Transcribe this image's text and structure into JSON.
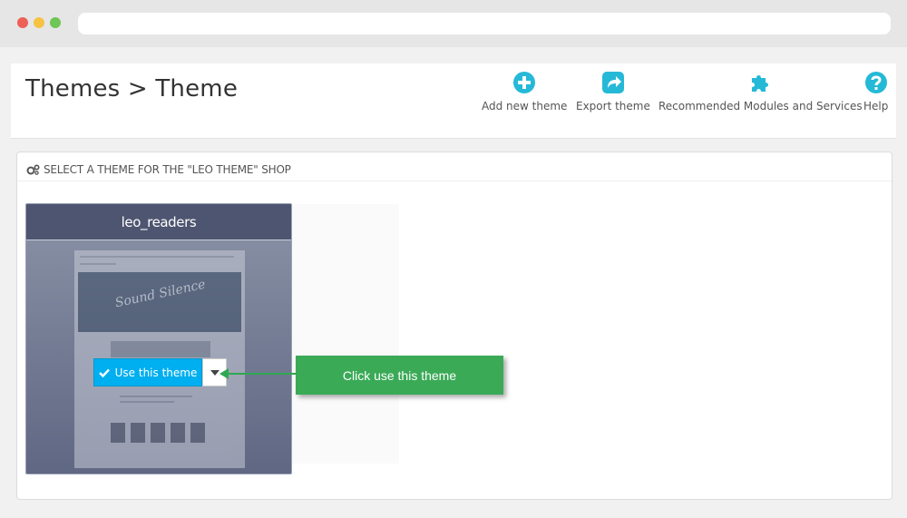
{
  "page": {
    "title": "Themes > Theme"
  },
  "toolbar": [
    {
      "label": "Add new theme",
      "icon": "plus-circle-icon"
    },
    {
      "label": "Export theme",
      "icon": "share-arrow-icon"
    },
    {
      "label": "Recommended Modules and Services",
      "icon": "puzzle-piece-icon"
    },
    {
      "label": "Help",
      "icon": "question-circle-icon"
    }
  ],
  "panel": {
    "heading": "SELECT A THEME FOR THE \"LEO THEME\" SHOP",
    "icon": "gears-icon"
  },
  "theme": {
    "name": "leo_readers",
    "use_label": "Use this theme"
  },
  "annotation": {
    "text": "Click use this theme"
  },
  "colors": {
    "accent": "#25b9d7",
    "use_button": "#00aff0",
    "callout": "#3aaa57",
    "card_header": "#4e5570"
  }
}
